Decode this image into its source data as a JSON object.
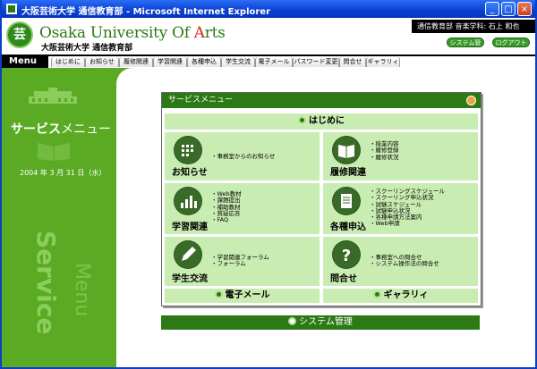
{
  "window": {
    "title": "大阪芸術大学 通信教育部 - Microsoft Internet Explorer",
    "minimize": "_",
    "maximize": "□",
    "close": "×"
  },
  "header": {
    "logo_char": "芸",
    "university_en_prefix": "Osaka ",
    "university_en_u": "U",
    "university_en_mid": "niversity Of ",
    "university_en_a": "A",
    "university_en_suffix": "rts",
    "university_jp": "大阪芸術大学 通信教育部",
    "user_info": "通信教育部 音楽学科: 石上 和也",
    "system_button": "システム管理",
    "logout_button": "ログアウト"
  },
  "nav": {
    "menu_label": "Menu",
    "items": [
      "はじめに",
      "お知らせ",
      "履修関連",
      "学習関連",
      "各種申込",
      "学生交流",
      "電子メール",
      "パスワード変更",
      "問合せ",
      "ギャラリィ"
    ]
  },
  "sidebar": {
    "title_bold": "サービス",
    "title_light": "メニュー",
    "date": "2004 年 3 月 31 日（水）",
    "watermark_1": "Service",
    "watermark_2": "Menu"
  },
  "panel": {
    "title": "サービスメニュー",
    "intro": "はじめに",
    "cells": [
      {
        "label": "お知らせ",
        "items": [
          "事務室からのお知らせ"
        ]
      },
      {
        "label": "履修関連",
        "items": [
          "授業内容",
          "履修登録",
          "履修状況"
        ]
      },
      {
        "label": "学習関連",
        "items": [
          "Web教材",
          "課題提出",
          "補助教材",
          "質疑応答",
          "FAQ"
        ]
      },
      {
        "label": "各種申込",
        "items": [
          "スクーリングスケジュール",
          "スクーリング申込状況",
          "試験スケジュール",
          "試験申込状況",
          "各種申請方法案内",
          "Web申請"
        ]
      },
      {
        "label": "学生交流",
        "items": [
          "学習関連フォーラム",
          "フォーラム"
        ]
      },
      {
        "label": "問合せ",
        "items": [
          "事務室への問合せ",
          "システム操作法の問合せ"
        ]
      }
    ],
    "email": "電子メール",
    "gallery": "ギャラリィ"
  },
  "system_admin": "システム管理",
  "colors": {
    "brand_green": "#2c7a16",
    "sidebar_green": "#5aaa24",
    "cell_green": "#c9ecb2"
  }
}
